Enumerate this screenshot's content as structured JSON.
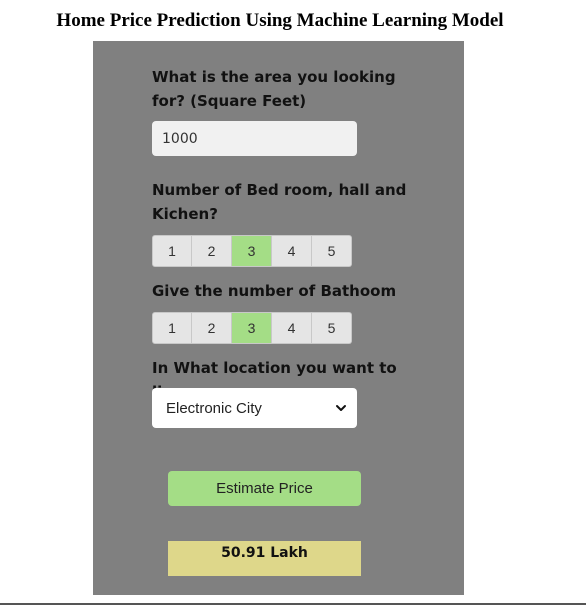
{
  "page": {
    "title": "Home Price Prediction Using Machine Learning Model"
  },
  "form": {
    "area": {
      "label": "What is the area you looking for? (Square Feet)",
      "value": "1000"
    },
    "bhk": {
      "label": "Number of Bed room, hall and Kichen?",
      "options": [
        "1",
        "2",
        "3",
        "4",
        "5"
      ],
      "selected": "3"
    },
    "bath": {
      "label": "Give the number of Bathoom",
      "options": [
        "1",
        "2",
        "3",
        "4",
        "5"
      ],
      "selected": "3"
    },
    "location": {
      "label": "In What location you want to live",
      "selected": "Electronic City"
    },
    "estimate_label": "Estimate Price"
  },
  "result": {
    "value": "50.91 Lakh"
  },
  "colors": {
    "panel": "#808080",
    "active": "#a4dd86",
    "result_bg": "#ded78a",
    "input_bg": "#f1f1f1"
  }
}
